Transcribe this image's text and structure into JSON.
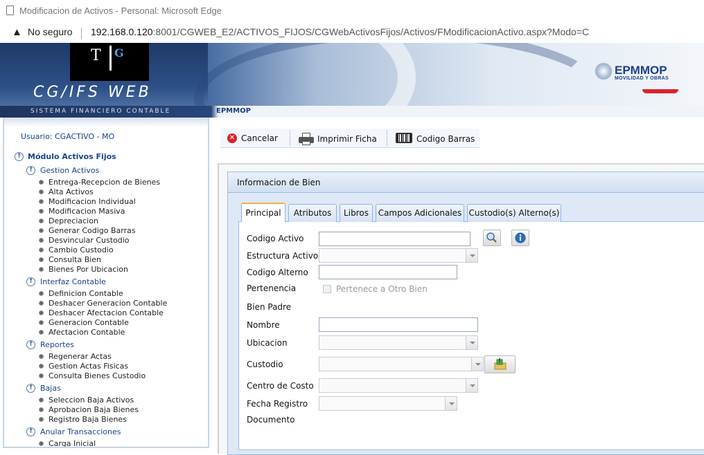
{
  "window": {
    "title": "Modificacion de Activos - Personal: Microsoft Edge"
  },
  "address_bar": {
    "security": "No seguro",
    "host": "192.168.0.120",
    "url_rest": ":8001/CGWEB_E2/ACTIVOS_FIJOS/CGWebActivosFijos/Activos/FModificacionActivo.aspx?Modo=C"
  },
  "header": {
    "logo_t": "T",
    "logo_g": "G",
    "app_name": "CG/IFS WEB",
    "app_subtitle": "SISTEMA FINANCIERO CONTABLE",
    "org_logo": "EPMMOP",
    "org_logo_sub": "MOVILIDAD Y OBRAS",
    "breadcrumb": "EPMMOP"
  },
  "sidebar": {
    "user_label": "Usuario: CGACTIVO - MO",
    "module": "Módulo Activos Fijos",
    "groups": [
      {
        "label": "Gestion Activos",
        "items": [
          "Entrega-Recepcion de Bienes",
          "Alta Activos",
          "Modificacion Individual",
          "Modificacion Masiva",
          "Depreciacion",
          "Generar Codigo Barras",
          "Desvincular Custodio",
          "Cambio Custodio",
          "Consulta Bien",
          "Bienes Por Ubicacion"
        ]
      },
      {
        "label": "Interfaz Contable",
        "items": [
          "Definicion Contable",
          "Deshacer Generacion Contable",
          "Deshacer Afectacion Contable",
          "Generacion Contable",
          "Afectacion Contable"
        ]
      },
      {
        "label": "Reportes",
        "items": [
          "Regenerar Actas",
          "Gestion Actas Fisicas",
          "Consulta Bienes Custodio"
        ]
      },
      {
        "label": "Bajas",
        "items": [
          "Seleccion Baja Activos",
          "Aprobacion Baja Bienes",
          "Registro Baja Bienes"
        ]
      },
      {
        "label": "Anular Transacciones",
        "items": [
          "Carga Inicial"
        ]
      }
    ]
  },
  "toolbar": {
    "cancel": "Cancelar",
    "print": "Imprimir Ficha",
    "barcode": "Codigo Barras"
  },
  "panel": {
    "title": "Informacion de Bien"
  },
  "tabs": [
    "Principal",
    "Atributos",
    "Libros",
    "Campos Adicionales",
    "Custodio(s) Alterno(s)"
  ],
  "form": {
    "codigo_activo": {
      "label": "Codigo Activo",
      "value": ""
    },
    "estructura": {
      "label": "Estructura Activos",
      "value": ""
    },
    "codigo_alterno": {
      "label": "Codigo Alterno",
      "value": ""
    },
    "pertenencia": {
      "label": "Pertenencia",
      "checkbox_label": "Pertenece a Otro Bien",
      "checked": false
    },
    "bien_padre": {
      "label": "Bien Padre"
    },
    "nombre": {
      "label": "Nombre",
      "value": ""
    },
    "ubicacion": {
      "label": "Ubicacion",
      "value": ""
    },
    "custodio": {
      "label": "Custodio",
      "value": ""
    },
    "centro_costo": {
      "label": "Centro de Costo",
      "value": ""
    },
    "fecha_registro": {
      "label": "Fecha Registro",
      "value": ""
    },
    "documento": {
      "label": "Documento"
    }
  },
  "colors": {
    "accent": "#15428b",
    "tab_active": "#f5b042",
    "cancel_icon": "#d9232d"
  }
}
